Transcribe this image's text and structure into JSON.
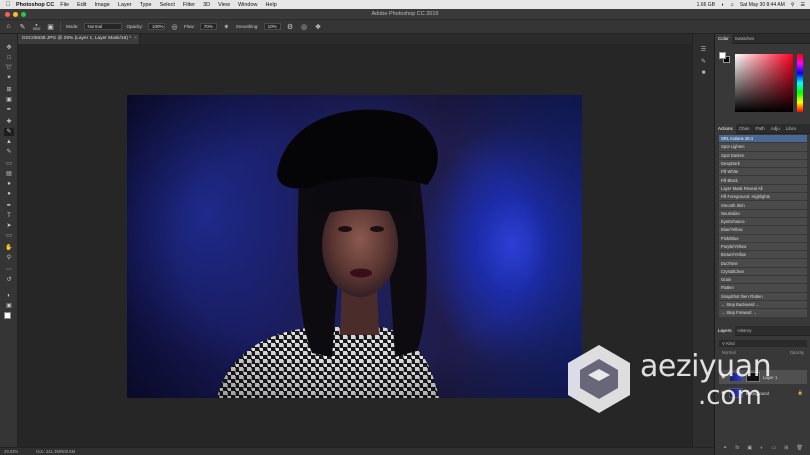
{
  "menubar": {
    "app_name": "Photoshop CC",
    "items": [
      "File",
      "Edit",
      "Image",
      "Layer",
      "Type",
      "Select",
      "Filter",
      "3D",
      "View",
      "Window",
      "Help"
    ],
    "battery": "1.66 GB",
    "datetime": "Sat May 30  8:44 AM"
  },
  "window": {
    "title": "Adobe Photoshop CC 2019"
  },
  "options": {
    "brush_size": "2500",
    "mode_label": "Mode:",
    "mode_value": "Normal",
    "opacity_label": "Opacity:",
    "opacity_value": "100%",
    "flow_label": "Flow:",
    "flow_value": "70%",
    "smoothing_label": "Smoothing:",
    "smoothing_value": "10%"
  },
  "document": {
    "tab_label": "DSC06538.JPG @ 29% (Layer 1, Layer Mask/16) *",
    "zoom": "29.03%",
    "doc_size": "Doc: 241.3M/500.6M"
  },
  "panels": {
    "color_tabs": [
      "Color",
      "Swatches"
    ],
    "actions_tabs": [
      "Actions",
      "Chan",
      "Path",
      "Adju",
      "Libra"
    ],
    "actions": [
      "SRL Actions 20.4",
      "Spot Lighten",
      "Spot Darken",
      "DeepDark",
      "Fill White",
      "Fill Black",
      "Layer Mask Reveal All",
      "Fill Foreground: Highlights",
      "Smooth Skin",
      "Neutralize",
      "EyeEnhance",
      "Blue/Yellow",
      "Pink/Blue",
      "Purple/Yellow",
      "Brown/Yellow",
      "DuoTone",
      "CrystalClear",
      "Grain",
      "Flatten",
      "SnapShot then Flatten",
      "← Step Backward ←",
      "→ Step Forward →"
    ],
    "layers_tabs": [
      "Layers",
      "History"
    ],
    "filter_label": "Kind",
    "blend_mode": "Normal",
    "opacity": "Opacity",
    "layers": [
      "Layer 1",
      "Background"
    ]
  },
  "watermark": {
    "line1": "aeziyuan",
    "line2": ".com"
  }
}
